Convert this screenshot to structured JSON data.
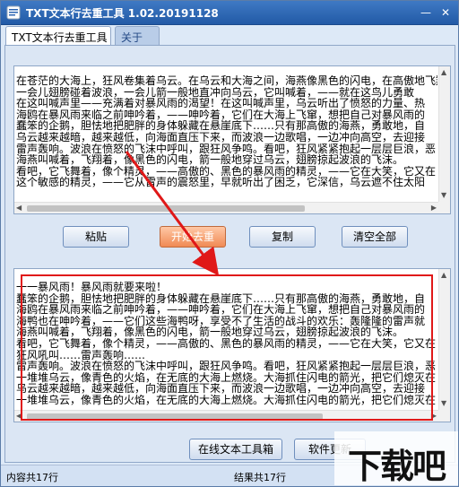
{
  "window": {
    "title": "TXT文本行去重工具 1.02.20191128",
    "minimize_glyph": "—",
    "close_glyph": "✕"
  },
  "tabs": [
    {
      "label": "TXT文本行去重工具",
      "active": true
    },
    {
      "label": "关于",
      "active": false
    }
  ],
  "input_text": {
    "lines": [
      "在苍茫的大海上，狂风卷集着乌云。在乌云和大海之间，海燕像黑色的闪电，在高傲地飞翔",
      "  一会儿翅膀碰着波浪，一会儿箭一般地直冲向乌云，它叫喊着，——就在这鸟儿勇敢",
      "  在这叫喊声里——充满着对暴风雨的渴望！在这叫喊声里，乌云听出了愤怒的力量、热",
      "  海鸥在暴风雨来临之前呻吟着，——呻吟着，它们在大海上飞窜，想把自己对暴风雨的",
      "  蠢笨的企鹅，胆怯地把肥胖的身体躲藏在悬崖底下……只有那高傲的海燕，勇敢地，自",
      "  乌云越来越暗，越来越低，向海面直压下来，而波浪一边歌唱，一边冲向高空，去迎接",
      "  雷声轰响。波浪在愤怒的飞沫中呼叫，跟狂风争鸣。看吧，狂风紧紧抱起一层层巨浪，恶",
      "  海燕叫喊着，飞翔着，像黑色的闪电，箭一般地穿过乌云，翅膀掠起波浪的飞沫。",
      "  看吧，它飞舞着，像个精灵，——高傲的、黑色的暴风雨的精灵，——它在大笑，它又在",
      "  这个敏感的精灵，——它从雷声的震怒里，早就听出了困乏，它深信，乌云遮不住太阳"
    ]
  },
  "buttons": {
    "paste": "粘贴",
    "dedupe": "开始去重",
    "copy": "复制",
    "clear": "清空全部",
    "online_tools": "在线文本工具箱",
    "update": "软件更新"
  },
  "output_text": {
    "lines": [
      "一一暴风雨！暴风雨就要来啦！",
      "蠢笨的企鹅，胆怯地把肥胖的身体躲藏在悬崖底下……只有那高傲的海燕，勇敢地，自",
      "海鸥在暴风雨来临之前呻吟着，——呻吟着，它们在大海上飞窜，想把自己对暴风雨的",
      "海鸭也在呻吟着，——它们这些海鸭呀，享受不了生活的战斗的欢乐：轰隆隆的雷声就",
      "海燕叫喊着，飞翔着，像黑色的闪电，箭一般地穿过乌云，翅膀掠起波浪的飞沫。",
      "看吧，它飞舞着，像个精灵，——高傲的、黑色的暴风雨的精灵，——它在大笑，它又在",
      "狂风吼叫……雷声轰响……",
      "雷声轰响。波浪在愤怒的飞沫中呼叫，跟狂风争鸣。看吧，狂风紧紧抱起一层层巨浪，恶",
      "一堆堆乌云，像青色的火焰，在无底的大海上燃烧。大海抓住闪电的箭光，把它们熄灭在",
      "乌云越来越暗，越来越低，向海面直压下来，而波浪一边歌唱，一边冲向高空，去迎接",
      "一堆堆乌云，像青色的火焰，在无底的大海上燃烧。大海抓住闪电的箭光，把它们熄灭在"
    ]
  },
  "status": {
    "content_count": "内容共17行",
    "result_count": "结果共17行"
  },
  "watermark": {
    "text": "下载吧"
  },
  "colors": {
    "annotation": "#e01818",
    "titlebar": "#2b64b2"
  }
}
